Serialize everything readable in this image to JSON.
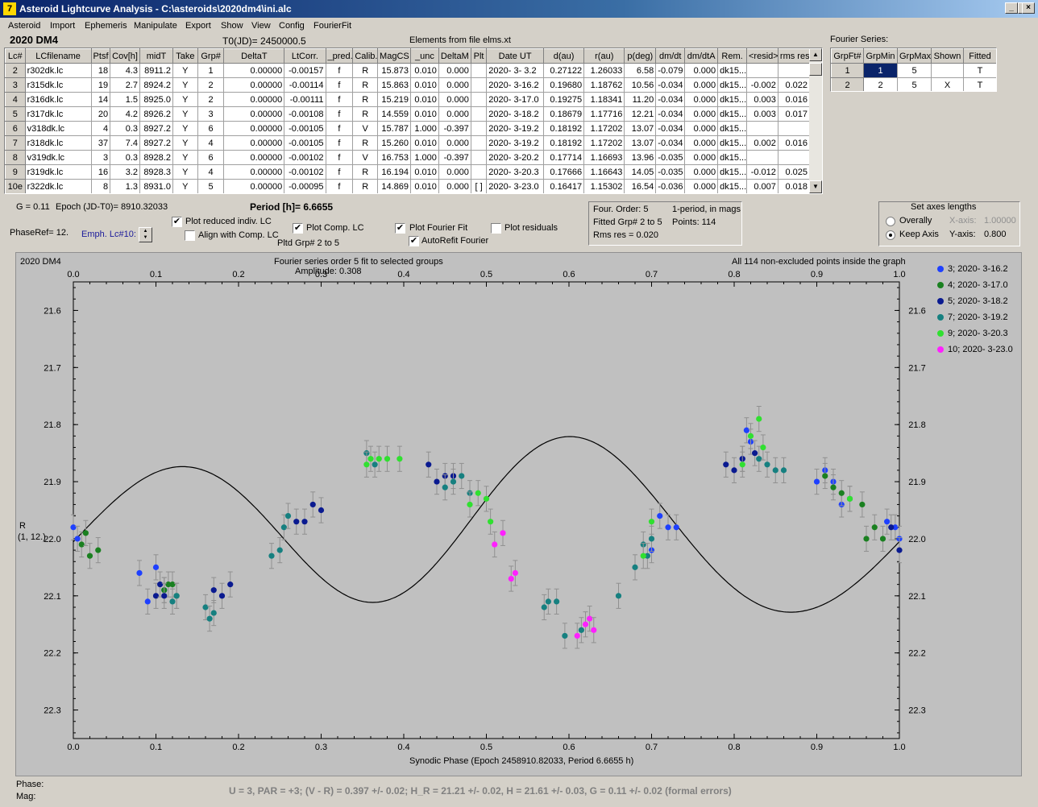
{
  "window": {
    "title": "Asteroid Lightcurve Analysis - C:\\asteroids\\2020dm4\\ini.alc",
    "icon": "7"
  },
  "menu": [
    "Asteroid",
    "Import",
    "Ephemeris",
    "Manipulate",
    "Export",
    "Show",
    "View",
    "Config",
    "FourierFit"
  ],
  "header": {
    "object": "2020 DM4",
    "t0": "T0(JD)= 2450000.5",
    "elements": "Elements from file elms.xt",
    "fourier_label": "Fourier Series:"
  },
  "lc_table": {
    "columns": [
      "Lc#",
      "LCfilename",
      "Ptsf",
      "Cov[h]",
      "midT",
      "Take",
      "Grp#",
      "DeltaT",
      "LtCorr.",
      "_pred.",
      "Calib.",
      "MagCS",
      "_unc",
      "DeltaM",
      "Plt",
      "Date UT",
      "d(au)",
      "r(au)",
      "p(deg)",
      "dm/dt",
      "dm/dtA",
      "Rem.",
      "<resid>",
      "rms res"
    ],
    "rows": [
      [
        "2",
        "r302dk.lc",
        "18",
        "4.3",
        "8911.2",
        "Y",
        "1",
        "0.00000",
        "-0.00157",
        "f",
        "R",
        "15.873",
        "0.010",
        "0.000",
        "",
        "2020- 3- 3.2",
        "0.27122",
        "1.26033",
        "6.58",
        "-0.079",
        "0.000",
        "dk15...",
        "",
        ""
      ],
      [
        "3",
        "r315dk.lc",
        "19",
        "2.7",
        "8924.2",
        "Y",
        "2",
        "0.00000",
        "-0.00114",
        "f",
        "R",
        "15.863",
        "0.010",
        "0.000",
        "",
        "2020- 3-16.2",
        "0.19680",
        "1.18762",
        "10.56",
        "-0.034",
        "0.000",
        "dk15...",
        "-0.002",
        "0.022"
      ],
      [
        "4",
        "r316dk.lc",
        "14",
        "1.5",
        "8925.0",
        "Y",
        "2",
        "0.00000",
        "-0.00111",
        "f",
        "R",
        "15.219",
        "0.010",
        "0.000",
        "",
        "2020- 3-17.0",
        "0.19275",
        "1.18341",
        "11.20",
        "-0.034",
        "0.000",
        "dk15...",
        "0.003",
        "0.016"
      ],
      [
        "5",
        "r317dk.lc",
        "20",
        "4.2",
        "8926.2",
        "Y",
        "3",
        "0.00000",
        "-0.00108",
        "f",
        "R",
        "14.559",
        "0.010",
        "0.000",
        "",
        "2020- 3-18.2",
        "0.18679",
        "1.17716",
        "12.21",
        "-0.034",
        "0.000",
        "dk15...",
        "0.003",
        "0.017"
      ],
      [
        "6",
        "v318dk.lc",
        "4",
        "0.3",
        "8927.2",
        "Y",
        "6",
        "0.00000",
        "-0.00105",
        "f",
        "V",
        "15.787",
        "1.000",
        "-0.397",
        "",
        "2020- 3-19.2",
        "0.18192",
        "1.17202",
        "13.07",
        "-0.034",
        "0.000",
        "dk15...",
        "",
        ""
      ],
      [
        "7",
        "r318dk.lc",
        "37",
        "7.4",
        "8927.2",
        "Y",
        "4",
        "0.00000",
        "-0.00105",
        "f",
        "R",
        "15.260",
        "0.010",
        "0.000",
        "",
        "2020- 3-19.2",
        "0.18192",
        "1.17202",
        "13.07",
        "-0.034",
        "0.000",
        "dk15...",
        "0.002",
        "0.016"
      ],
      [
        "8",
        "v319dk.lc",
        "3",
        "0.3",
        "8928.2",
        "Y",
        "6",
        "0.00000",
        "-0.00102",
        "f",
        "V",
        "16.753",
        "1.000",
        "-0.397",
        "",
        "2020- 3-20.2",
        "0.17714",
        "1.16693",
        "13.96",
        "-0.035",
        "0.000",
        "dk15...",
        "",
        ""
      ],
      [
        "9",
        "r319dk.lc",
        "16",
        "3.2",
        "8928.3",
        "Y",
        "4",
        "0.00000",
        "-0.00102",
        "f",
        "R",
        "16.194",
        "0.010",
        "0.000",
        "",
        "2020- 3-20.3",
        "0.17666",
        "1.16643",
        "14.05",
        "-0.035",
        "0.000",
        "dk15...",
        "-0.012",
        "0.025"
      ],
      [
        "10e",
        "r322dk.lc",
        "8",
        "1.3",
        "8931.0",
        "Y",
        "5",
        "0.00000",
        "-0.00095",
        "f",
        "R",
        "14.869",
        "0.010",
        "0.000",
        "[ ]",
        "2020- 3-23.0",
        "0.16417",
        "1.15302",
        "16.54",
        "-0.036",
        "0.000",
        "dk15...",
        "0.007",
        "0.018"
      ]
    ]
  },
  "fourier_table": {
    "columns": [
      "GrpFt#",
      "GrpMin",
      "GrpMax",
      "Shown",
      "Fitted"
    ],
    "rows": [
      [
        "1",
        "1",
        "5",
        "",
        "T"
      ],
      [
        "2",
        "2",
        "5",
        "X",
        "T"
      ]
    ]
  },
  "controls": {
    "g_text": "G = 0.11",
    "epoch_text": "Epoch (JD-T0)= 8910.32033",
    "period_text": "Period [h]= 6.6655",
    "phaseref_text": "PhaseRef= 12.",
    "emph_text": "Emph. Lc#10:",
    "plot_reduced": "Plot reduced indiv. LC",
    "align_comp": "Align with Comp. LC",
    "plot_comp": "Plot Comp. LC",
    "pltd_grp": "Pltd Grp#  2   to   5",
    "plot_fourier": "Plot Fourier Fit",
    "autorefit": "AutoRefit Fourier",
    "plot_residuals": "Plot residuals",
    "four_order": "Four. Order:  5",
    "one_period": "1-period, in mags",
    "fitted_grp": "Fitted Grp# 2 to 5",
    "points": "Points: 114",
    "rms_res": "Rms res      = 0.020",
    "axes_title": "Set axes lengths",
    "overally": "Overally",
    "keep_axis": "Keep Axis",
    "x_axis_label": "X-axis:",
    "x_axis_value": "1.00000",
    "y_axis_label": "Y-axis:",
    "y_axis_value": "0.800",
    "checks": {
      "plot_reduced": true,
      "align_comp": false,
      "plot_comp": true,
      "plot_fourier": true,
      "autorefit": true,
      "plot_residuals": false
    },
    "radio_selected": "keep_axis"
  },
  "plot": {
    "name": "2020 DM4",
    "fit_title": "Fourier series order 5 fit to selected groups",
    "amplitude": "Amplitude: 0.308",
    "points_note": "All 114 non-excluded points inside the graph",
    "ylabel_top": "R",
    "ylabel_bottom": "(1, 12.)",
    "xlabel": "Synodic Phase (Epoch 2458910.82033, Period 6.6655 h)"
  },
  "chart_data": {
    "type": "scatter",
    "xlim": [
      0.0,
      1.0
    ],
    "ylim": [
      21.55,
      22.35
    ],
    "y_inverted": true,
    "x_ticks": [
      "0.0",
      "0.1",
      "0.2",
      "0.3",
      "0.4",
      "0.5",
      "0.6",
      "0.7",
      "0.8",
      "0.9",
      "1.0"
    ],
    "y_ticks": [
      "21.6",
      "21.7",
      "21.8",
      "21.9",
      "22.0",
      "22.1",
      "22.2",
      "22.3"
    ],
    "legend_position": "right",
    "fourier_fit_shown": true,
    "series": [
      {
        "name": "3; 2020- 3-16.2",
        "color": "#1e40ff",
        "points": [
          [
            0.0,
            21.98
          ],
          [
            0.005,
            22.0
          ],
          [
            0.08,
            22.06
          ],
          [
            0.09,
            22.11
          ],
          [
            0.1,
            22.05
          ],
          [
            0.11,
            22.09
          ],
          [
            0.9,
            21.9
          ],
          [
            0.91,
            21.88
          ],
          [
            0.92,
            21.9
          ],
          [
            0.93,
            21.94
          ],
          [
            0.7,
            22.02
          ],
          [
            0.71,
            21.96
          ],
          [
            0.72,
            21.98
          ],
          [
            0.73,
            21.98
          ],
          [
            0.815,
            21.81
          ],
          [
            0.81,
            21.86
          ],
          [
            0.82,
            21.83
          ],
          [
            0.985,
            21.97
          ],
          [
            0.995,
            21.98
          ],
          [
            1.0,
            22.0
          ]
        ]
      },
      {
        "name": "4; 2020- 3-17.0",
        "color": "#1a8020",
        "points": [
          [
            0.01,
            22.01
          ],
          [
            0.015,
            21.99
          ],
          [
            0.02,
            22.03
          ],
          [
            0.03,
            22.02
          ],
          [
            0.11,
            22.09
          ],
          [
            0.115,
            22.08
          ],
          [
            0.12,
            22.08
          ],
          [
            0.125,
            22.1
          ],
          [
            0.91,
            21.89
          ],
          [
            0.92,
            21.91
          ],
          [
            0.93,
            21.92
          ],
          [
            0.96,
            22.0
          ],
          [
            0.97,
            21.98
          ],
          [
            0.955,
            21.94
          ],
          [
            0.98,
            22.0
          ]
        ]
      },
      {
        "name": "5; 2020- 3-18.2",
        "color": "#0a1a90",
        "points": [
          [
            0.1,
            22.1
          ],
          [
            0.105,
            22.08
          ],
          [
            0.11,
            22.1
          ],
          [
            0.17,
            22.09
          ],
          [
            0.18,
            22.1
          ],
          [
            0.19,
            22.08
          ],
          [
            0.27,
            21.97
          ],
          [
            0.28,
            21.97
          ],
          [
            0.29,
            21.94
          ],
          [
            0.3,
            21.95
          ],
          [
            0.43,
            21.87
          ],
          [
            0.44,
            21.9
          ],
          [
            0.45,
            21.89
          ],
          [
            0.46,
            21.89
          ],
          [
            0.79,
            21.87
          ],
          [
            0.8,
            21.88
          ],
          [
            0.81,
            21.86
          ],
          [
            0.825,
            21.85
          ],
          [
            0.99,
            21.98
          ],
          [
            1.0,
            22.02
          ]
        ]
      },
      {
        "name": "7; 2020- 3-19.2",
        "color": "#168080",
        "points": [
          [
            0.12,
            22.11
          ],
          [
            0.125,
            22.1
          ],
          [
            0.16,
            22.12
          ],
          [
            0.165,
            22.14
          ],
          [
            0.17,
            22.13
          ],
          [
            0.24,
            22.03
          ],
          [
            0.25,
            22.02
          ],
          [
            0.255,
            21.98
          ],
          [
            0.26,
            21.96
          ],
          [
            0.355,
            21.85
          ],
          [
            0.365,
            21.87
          ],
          [
            0.45,
            21.91
          ],
          [
            0.46,
            21.9
          ],
          [
            0.47,
            21.89
          ],
          [
            0.48,
            21.92
          ],
          [
            0.57,
            22.12
          ],
          [
            0.575,
            22.11
          ],
          [
            0.585,
            22.11
          ],
          [
            0.595,
            22.17
          ],
          [
            0.615,
            22.16
          ],
          [
            0.66,
            22.1
          ],
          [
            0.68,
            22.05
          ],
          [
            0.69,
            22.01
          ],
          [
            0.695,
            22.03
          ],
          [
            0.7,
            22.0
          ],
          [
            0.83,
            21.86
          ],
          [
            0.84,
            21.87
          ],
          [
            0.85,
            21.88
          ],
          [
            0.86,
            21.88
          ],
          [
            0.94,
            21.93
          ]
        ]
      },
      {
        "name": "9; 2020- 3-20.3",
        "color": "#30e030",
        "points": [
          [
            0.355,
            21.87
          ],
          [
            0.36,
            21.86
          ],
          [
            0.37,
            21.86
          ],
          [
            0.38,
            21.86
          ],
          [
            0.395,
            21.86
          ],
          [
            0.48,
            21.94
          ],
          [
            0.49,
            21.92
          ],
          [
            0.5,
            21.93
          ],
          [
            0.505,
            21.97
          ],
          [
            0.69,
            22.03
          ],
          [
            0.7,
            21.97
          ],
          [
            0.81,
            21.87
          ],
          [
            0.82,
            21.82
          ],
          [
            0.83,
            21.79
          ],
          [
            0.835,
            21.84
          ],
          [
            0.94,
            21.93
          ]
        ]
      },
      {
        "name": "10; 2020- 3-23.0",
        "color": "#ff20ff",
        "points": [
          [
            0.51,
            22.01
          ],
          [
            0.52,
            21.99
          ],
          [
            0.53,
            22.07
          ],
          [
            0.535,
            22.06
          ],
          [
            0.61,
            22.17
          ],
          [
            0.62,
            22.15
          ],
          [
            0.625,
            22.14
          ],
          [
            0.63,
            22.16
          ]
        ]
      }
    ]
  },
  "status": {
    "phase_label": "Phase:",
    "mag_label": "Mag:",
    "summary": "U = 3, PAR = +3; (V - R) = 0.397 +/- 0.02; H_R = 21.21 +/- 0.02, H = 21.61 +/- 0.03, G = 0.11 +/- 0.02 (formal errors)"
  }
}
